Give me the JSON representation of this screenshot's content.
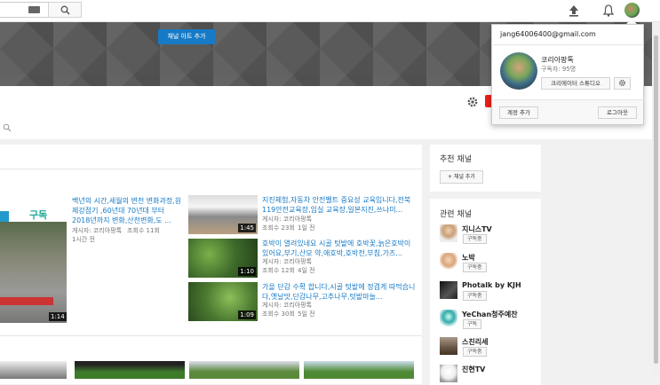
{
  "topbar": {
    "search_icon": "search-icon",
    "upload_icon": "upload-icon",
    "bell_icon": "bell-icon"
  },
  "banner": {
    "add_art_button": "채널 아트 추가"
  },
  "featured": {
    "thumb_text": "구독",
    "title": "백년의 시간,세월의 변천 변화과정,원제강점기 ,60년대 70년대 부터 2018년까지 변화,산천변화,도 ...",
    "author": "게시자: 코리아팡톡",
    "views": "조회수 11회",
    "age": "1시간 전",
    "duration": "1:14"
  },
  "videos": [
    {
      "title": "지진체험,자동차 안전벨트 중요성 교육입니다,전북 119안전교육장,임실 교육장,일본지진,쓰나미...",
      "author": "게시자: 코리아팡톡",
      "views": "조회수 23회",
      "age": "1일 전",
      "duration": "1:45"
    },
    {
      "title": "호박이 열려있네요 시골 텃밭에 호박꽃,늙은호박이 있어요,부기,산모 약,애호박,호박전,부침,가즈...",
      "author": "게시자: 코리아팡톡",
      "views": "조회수 12회",
      "age": "4일 전",
      "duration": "1:10"
    },
    {
      "title": "가을 단감 수확 합니다,시골 텃밭에 정겹게 따먹습니다,옛날맛,단감나무,고추나무,텃밭마늘...",
      "author": "게시자: 코리아팡톡",
      "views": "조회수 30회",
      "age": "5일 전",
      "duration": "1:09"
    }
  ],
  "sidebar": {
    "recommended_title": "추천 채널",
    "add_channel_button": "+ 채널 추가",
    "related_title": "관련 채널",
    "related": [
      {
        "name": "지니스TV",
        "button": "구독중"
      },
      {
        "name": "노박",
        "button": "구독중"
      },
      {
        "name": "Photalk by KJH",
        "button": "구독중"
      },
      {
        "name": "YeChan청주예찬",
        "button": "구독"
      },
      {
        "name": "스친리세",
        "button": "구독중"
      },
      {
        "name": "진현TV",
        "button": ""
      }
    ]
  },
  "account_popup": {
    "email": "jang64006400@gmail.com",
    "channel_name": "코리아팡톡",
    "subscribers": "구독자: 95명",
    "creator_studio_button": "크리에이터 스튜디오",
    "add_account_button": "계정 추가",
    "logout_button": "로그아웃"
  },
  "colors": {
    "link": "#167ac6",
    "accent_red": "#e62117"
  }
}
